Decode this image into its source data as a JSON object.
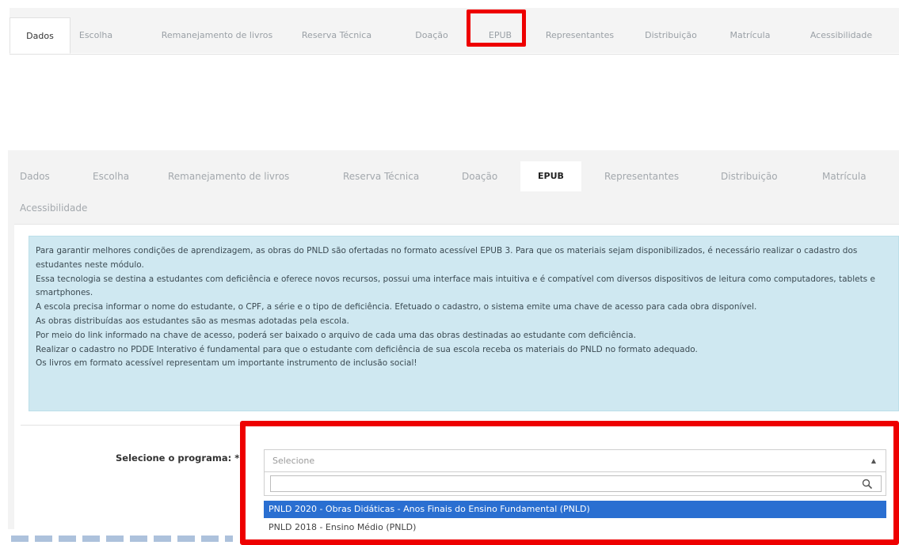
{
  "top_tabs": [
    {
      "label": "Dados",
      "active": true
    },
    {
      "label": "Escolha"
    },
    {
      "label": "Remanejamento de livros"
    },
    {
      "label": "Reserva Técnica"
    },
    {
      "label": "Doação"
    },
    {
      "label": "EPUB"
    },
    {
      "label": "Representantes"
    },
    {
      "label": "Distribuição"
    },
    {
      "label": "Matrícula"
    },
    {
      "label": "Acessibilidade"
    }
  ],
  "mid_tabs": [
    {
      "label": "Dados"
    },
    {
      "label": "Escolha"
    },
    {
      "label": "Remanejamento de livros"
    },
    {
      "label": "Reserva Técnica"
    },
    {
      "label": "Doação"
    },
    {
      "label": "EPUB",
      "active": true
    },
    {
      "label": "Representantes"
    },
    {
      "label": "Distribuição"
    },
    {
      "label": "Matrícula"
    },
    {
      "label": "Acessibilidade"
    }
  ],
  "info_paragraphs": [
    "Para garantir melhores condições de aprendizagem, as obras do PNLD são ofertadas no formato acessível EPUB 3. Para que os materiais sejam disponibilizados, é necessário realizar o cadastro dos estudantes neste módulo.",
    "Essa tecnologia se destina a estudantes com deficiência e oferece novos recursos, possui uma interface mais intuitiva e é compatível com diversos dispositivos de leitura como computadores, tablets e smartphones.",
    "A escola precisa informar o nome do estudante, o CPF, a série e o tipo de deficiência. Efetuado o cadastro, o sistema emite uma chave de acesso para cada obra disponível.",
    "As obras distribuídas aos estudantes são as mesmas adotadas pela escola.",
    "Por meio do link informado na chave de acesso, poderá ser baixado o arquivo de cada uma das obras destinadas ao estudante com deficiência.",
    "Realizar o cadastro no PDDE Interativo é fundamental para que o estudante com deficiência de sua escola receba os materiais do PNLD no formato adequado.",
    "Os livros em formato acessível representam um importante instrumento de inclusão social!"
  ],
  "form": {
    "label": "Selecione o programa: *",
    "select_placeholder": "Selecione",
    "search_value": "",
    "options": [
      "PNLD 2020 - Obras Didáticas - Anos Finais do Ensino Fundamental (PNLD)",
      "PNLD 2018 - Ensino Médio (PNLD)"
    ]
  },
  "colors": {
    "highlight_border": "#ee0000",
    "option_highlight": "#2a6fd1",
    "alert_bg": "#cfe8f1"
  }
}
